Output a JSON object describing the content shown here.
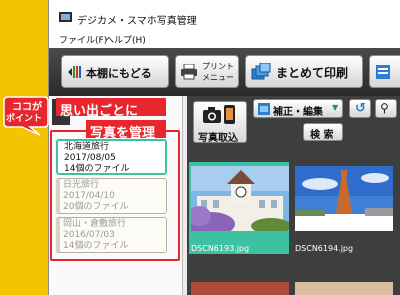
{
  "window": {
    "title": "デジカメ・スマホ写真管理"
  },
  "menu": {
    "file": "ファイル(F)",
    "help": "ヘルプ(H)"
  },
  "toolbar": {
    "back_label": "本棚にもどる",
    "print_label": "プリント",
    "print_sub": "メニュー",
    "batch_label": "まとめて印刷"
  },
  "albums": [
    {
      "name": "北海道旅行",
      "date": "2017/08/05",
      "count": "14個のファイル",
      "selected": true
    },
    {
      "name": "日光旅行",
      "date": "2017/04/10",
      "count": "20個のファイル",
      "selected": false
    },
    {
      "name": "岡山・倉敷旅行",
      "date": "2016/07/03",
      "count": "14個のファイル",
      "selected": false
    }
  ],
  "main": {
    "import_label": "写真取込",
    "edit_label": "補正・編集",
    "search_label": "検 索"
  },
  "photos": [
    {
      "filename": "DSCN6193.jpg",
      "selected": true
    },
    {
      "filename": "DSCN6194.jpg",
      "selected": false
    }
  ],
  "callout": {
    "badge_line1": "ココが",
    "badge_line2": "ポイント",
    "text_line1": "思い出ごとに",
    "text_line2": "写真を管理"
  },
  "colors": {
    "background": "#f5c400",
    "accent_red": "#e8262e",
    "selection_teal": "#3cc2a2",
    "toolbar_dark": "#333333"
  }
}
